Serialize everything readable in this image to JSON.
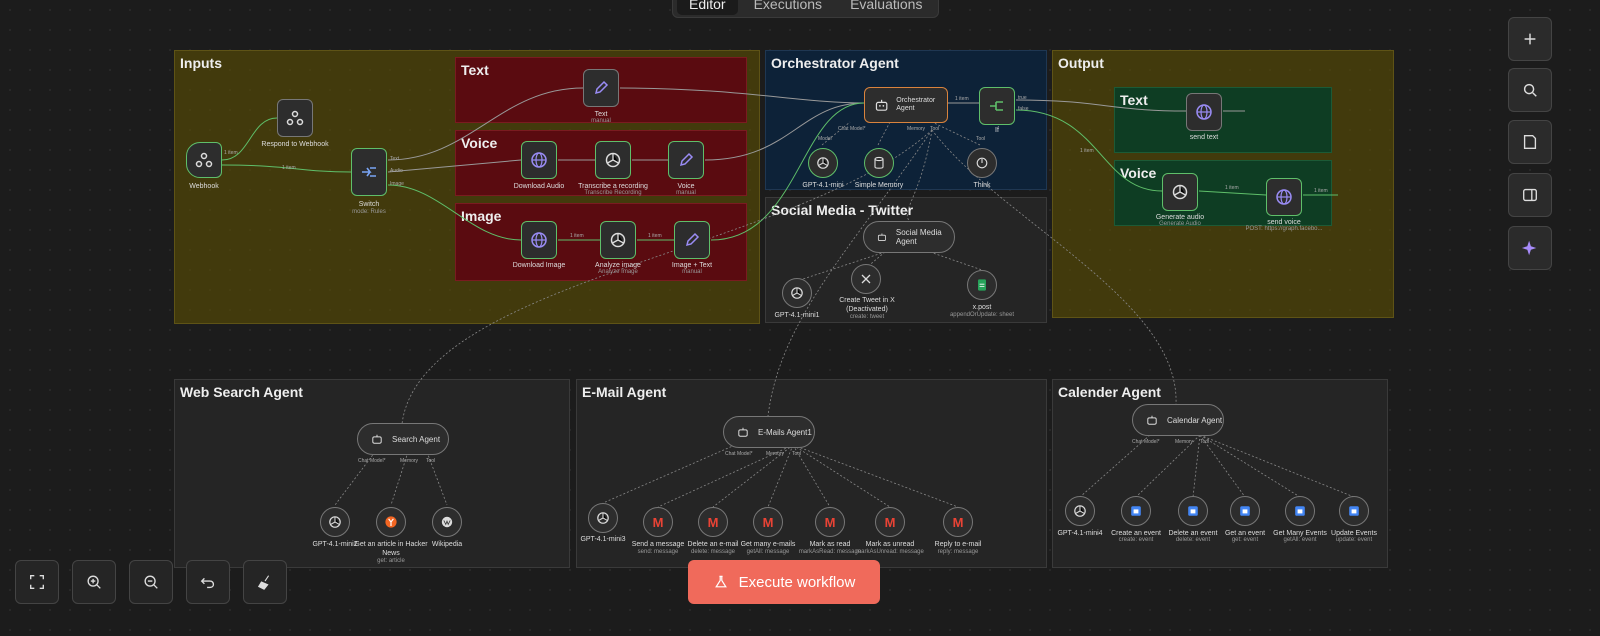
{
  "tabs": [
    "Editor",
    "Executions",
    "Evaluations"
  ],
  "groups": {
    "inputs": "Inputs",
    "text": "Text",
    "voice": "Voice",
    "image": "Image",
    "orchestrator": "Orchestrator Agent",
    "output": "Output",
    "output_text": "Text",
    "output_voice": "Voice",
    "social": "Social Media - Twitter",
    "web": "Web Search Agent",
    "email": "E-Mail Agent",
    "calendar": "Calender Agent"
  },
  "nodes": {
    "webhook": "Webhook",
    "respond": "Respond to Webhook",
    "switch": "Switch",
    "switch_sub": "mode: Rules",
    "text": "Text",
    "text_sub": "manual",
    "download_audio": "Download Audio",
    "transcribe": "Transcribe a recording",
    "transcribe_sub": "Transcribe Recording",
    "voice": "Voice",
    "voice_sub": "manual",
    "download_image": "Download Image",
    "analyze": "Analyze image",
    "analyze_sub": "Analyze Image",
    "image_text": "Image + Text",
    "image_text_sub": "manual",
    "orchestrator": "Orchestrator Agent",
    "if": "If",
    "gpt41mini": "GPT-4.1-mini",
    "simple_memory": "Simple Memory",
    "think": "Think",
    "send_text": "send text",
    "generate_audio": "Generate audio",
    "generate_audio_sub": "Generate Audio",
    "send_voice": "send voice",
    "send_voice_sub": "POST: https://graph.facebo...",
    "social_agent": "Social Media Agent",
    "gpt41mini1": "GPT-4.1-mini1",
    "create_tweet": "Create Tweet in X (Deactivated)",
    "create_tweet_sub": "create: tweet",
    "xpost": "x.post",
    "xpost_sub": "appendOrUpdate: sheet",
    "search_agent": "Search Agent",
    "gpt41mini2": "GPT-4.1-mini2",
    "hacker_news": "Get an article in Hacker News",
    "hacker_news_sub": "get: article",
    "wikipedia": "Wikipedia",
    "emails_agent": "E-Mails Agent1",
    "gpt41mini3": "GPT-4.1-mini3",
    "send_message": "Send a message",
    "send_message_sub": "send: message",
    "delete_email": "Delete an e-mail",
    "delete_email_sub": "delete: message",
    "get_many_emails": "Get many e-mails",
    "get_many_emails_sub": "getAll: message",
    "mark_read": "Mark as read",
    "mark_read_sub": "markAsRead: message",
    "mark_unread": "Mark as unread",
    "mark_unread_sub": "markAsUnread: message",
    "reply": "Reply to e-mail",
    "reply_sub": "reply: message",
    "calendar_agent": "Calendar Agent",
    "gpt41mini4": "GPT-4.1-mini4",
    "create_event": "Create an event",
    "create_event_sub": "create: event",
    "delete_event": "Delete an event",
    "delete_event_sub": "delete: event",
    "get_event": "Get an event",
    "get_event_sub": "get: event",
    "get_many_events": "Get Many Events",
    "get_many_events_sub": "getAll: event",
    "update_events": "Update Events",
    "update_events_sub": "update: event"
  },
  "port_labels": {
    "chat_model": "Chat Model*",
    "model": "Model",
    "memory": "Memory",
    "tool": "Tool",
    "item": "1 item",
    "text": "Text",
    "audio": "Audio",
    "image": "Image",
    "true": "true",
    "false": "false"
  },
  "execute_button": "Execute workflow"
}
